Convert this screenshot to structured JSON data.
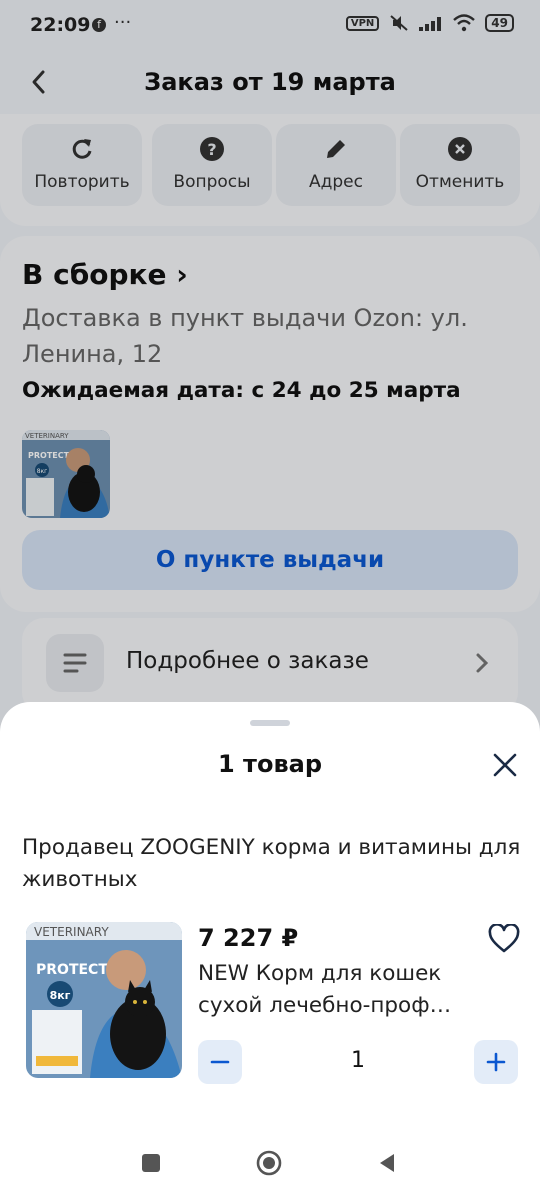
{
  "status_bar": {
    "time": "22:09",
    "fb_icon": "f",
    "more": "···",
    "vpn": "VPN",
    "battery": "49"
  },
  "header": {
    "title": "Заказ от 19 марта"
  },
  "actions": [
    {
      "label": "Повторить",
      "icon": "refresh-icon"
    },
    {
      "label": "Вопросы",
      "icon": "question-icon"
    },
    {
      "label": "Адрес",
      "icon": "pencil-icon"
    },
    {
      "label": "Отменить",
      "icon": "cancel-icon"
    }
  ],
  "order": {
    "status": "В сборке",
    "delivery": "Доставка в пункт выдачи Ozon: ул. Ленина, 12",
    "expected": "Ожидаемая дата: с 24 до 25 марта",
    "pickup_button": "О пункте выдачи",
    "details_link": "Подробнее о заказе"
  },
  "product_image": {
    "brand": "VETERINARY",
    "line": "PROTECT",
    "weight": "8кг"
  },
  "sheet": {
    "title": "1 товар",
    "seller": "Продавец ZOOGENIY корма и витамины для животных",
    "price": "7 227 ₽",
    "name": "NEW Корм для кошек сухой лечебно-проф…",
    "quantity": "1"
  },
  "colors": {
    "accent": "#0b57d0",
    "pickup_bg": "#d6e3f5",
    "qty_btn_bg": "#e3ecf8"
  }
}
